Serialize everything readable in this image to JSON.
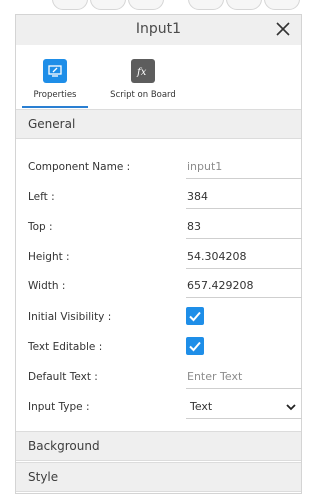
{
  "window": {
    "title": "Input1"
  },
  "tabs": [
    {
      "label": "Properties",
      "icon": "properties-icon",
      "active": true
    },
    {
      "label": "Script on Board",
      "icon": "fx-icon",
      "active": false
    }
  ],
  "sections": {
    "general": "General",
    "background": "Background",
    "style": "Style"
  },
  "properties": {
    "component_name": {
      "label": "Component Name :",
      "value": "input1"
    },
    "left": {
      "label": "Left :",
      "value": "384"
    },
    "top": {
      "label": "Top :",
      "value": "83"
    },
    "height": {
      "label": "Height :",
      "value": "54.304208"
    },
    "width": {
      "label": "Width :",
      "value": "657.429208"
    },
    "initial_visibility": {
      "label": "Initial Visibility :",
      "checked": true
    },
    "text_editable": {
      "label": "Text Editable :",
      "checked": true
    },
    "default_text": {
      "label": "Default Text :",
      "placeholder": "Enter Text"
    },
    "input_type": {
      "label": "Input Type :",
      "value": "Text"
    }
  },
  "colors": {
    "accent": "#1e8ee8",
    "tab_underline": "#2a7fd2",
    "header_bg": "#efefef"
  }
}
